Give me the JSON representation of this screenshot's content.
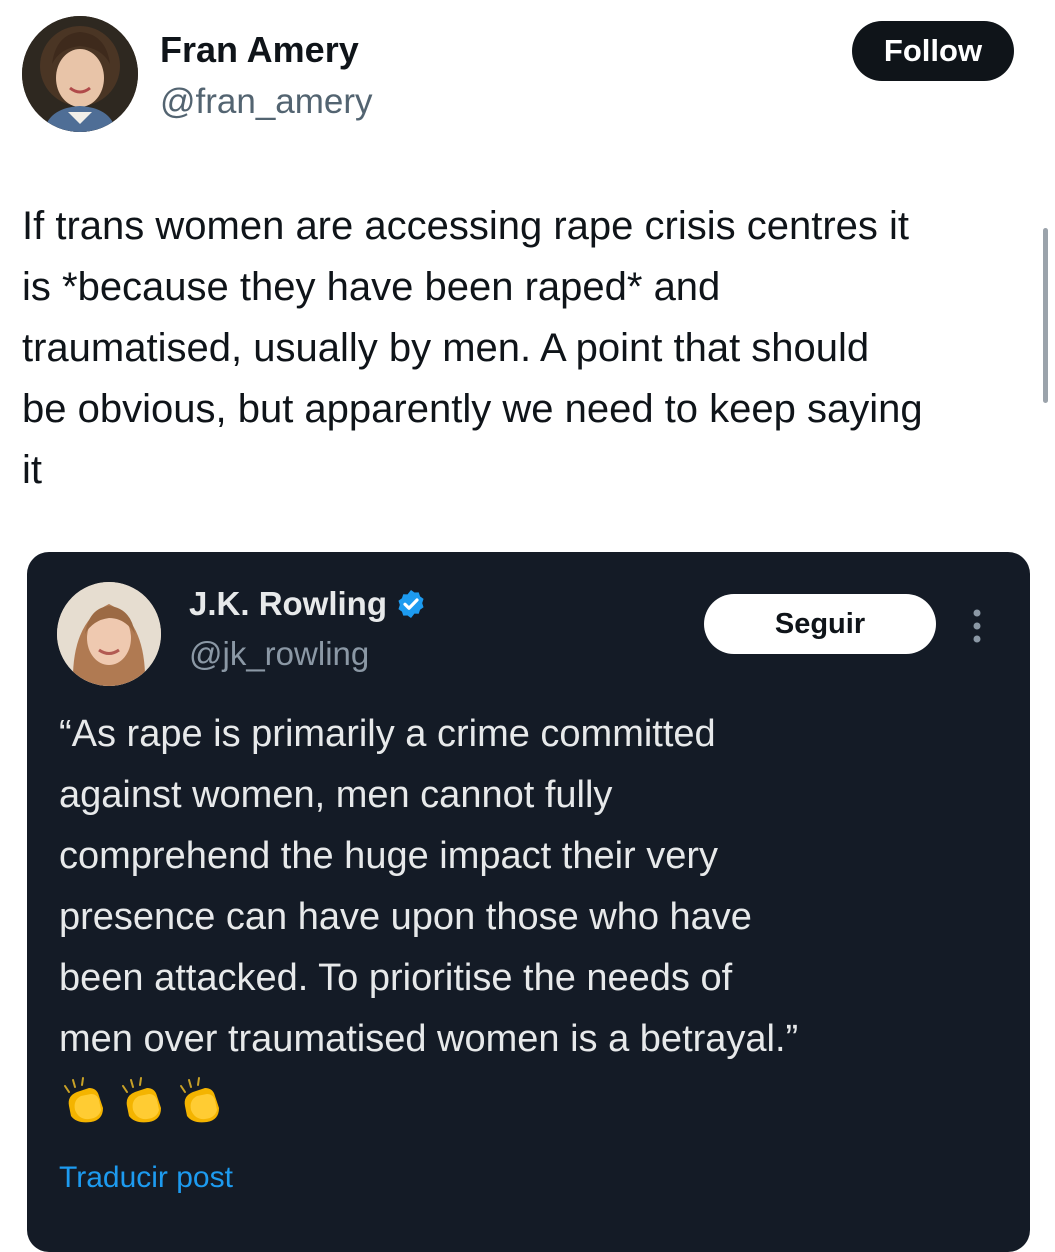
{
  "post": {
    "author_name": "Fran Amery",
    "author_handle": "@fran_amery",
    "follow_label": "Follow",
    "text_lines": [
      "If trans women are accessing rape crisis centres it",
      "is *because they have been raped* and",
      "traumatised, usually by men. A point that should",
      "be obvious, but apparently we need to keep saying",
      "it"
    ],
    "avatar_icon": "user-avatar"
  },
  "quoted_post": {
    "author_name": "J.K. Rowling",
    "author_handle": "@jk_rowling",
    "verified": true,
    "verified_icon": "verified-badge-icon",
    "follow_label": "Seguir",
    "more_icon": "more-options-icon",
    "text_lines": [
      "“As rape is primarily a crime committed",
      "against women, men cannot fully",
      "comprehend the huge impact their very",
      "presence can have upon those who have",
      "been attacked. To prioritise the needs of",
      "men over traumatised women is a betrayal.”"
    ],
    "emojis": [
      "clapping-hands",
      "clapping-hands",
      "clapping-hands"
    ],
    "translate_label": "Traducir post"
  },
  "colors": {
    "follow_button_bg": "#0f1419",
    "quote_card_bg": "#141b26",
    "link_blue": "#1d9bf0",
    "verified_blue": "#1d9bf0",
    "handle_gray": "#536471"
  }
}
